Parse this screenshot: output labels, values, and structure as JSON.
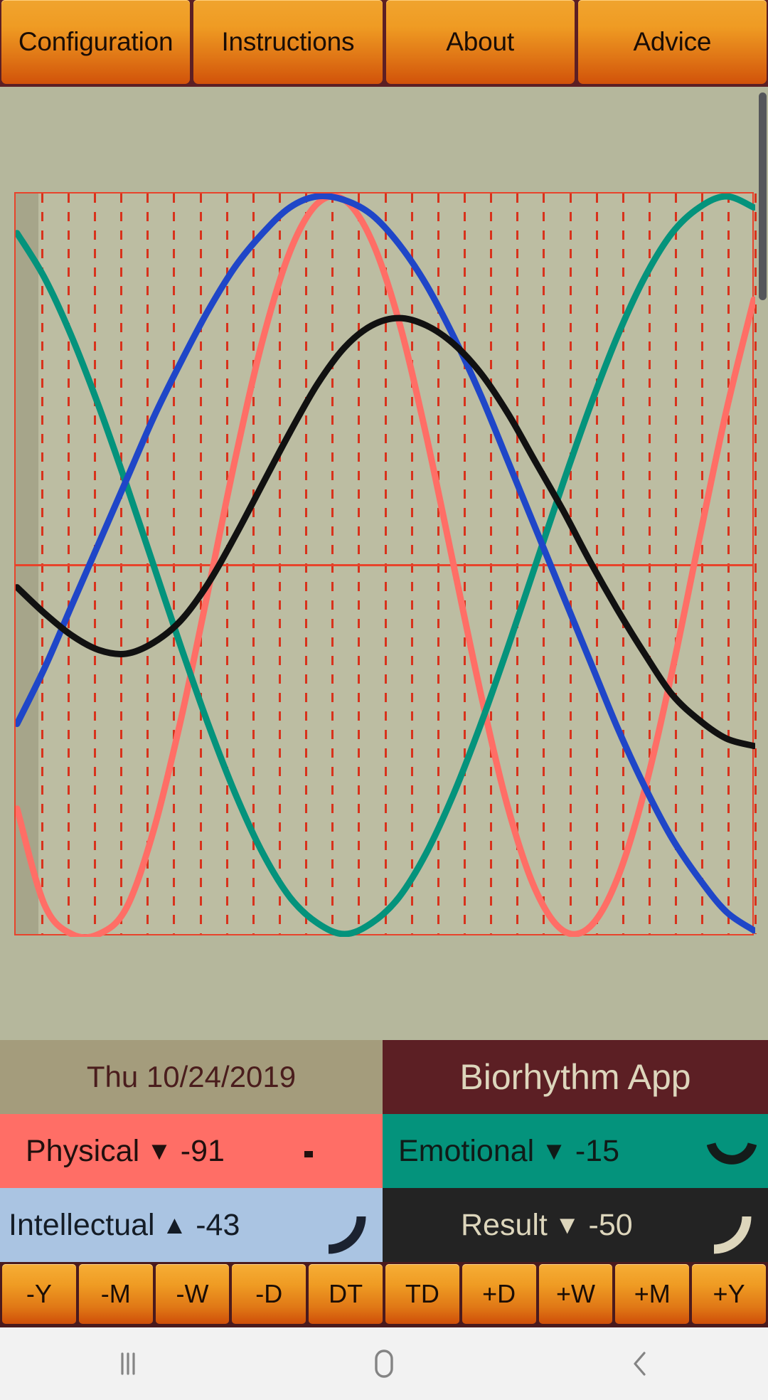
{
  "topbar": {
    "buttons": [
      {
        "label": "Configuration",
        "name": "tab-configuration"
      },
      {
        "label": "Instructions",
        "name": "tab-instructions"
      },
      {
        "label": "About",
        "name": "tab-about"
      },
      {
        "label": "Advice",
        "name": "tab-advice"
      }
    ]
  },
  "info": {
    "date": "Thu 10/24/2019",
    "app_title": "Biorhythm App",
    "physical": {
      "label": "Physical",
      "trend": "▼",
      "value": "-91"
    },
    "emotional": {
      "label": "Emotional",
      "trend": "▼",
      "value": "-15"
    },
    "intellectual": {
      "label": "Intellectual",
      "trend": "▲",
      "value": "-43"
    },
    "result": {
      "label": "Result",
      "trend": "▼",
      "value": "-50"
    }
  },
  "steps": {
    "buttons": [
      "-Y",
      "-M",
      "-W",
      "-D",
      "DT",
      "TD",
      "+D",
      "+W",
      "+M",
      "+Y"
    ]
  },
  "navbar": {
    "recents": "recents-icon",
    "home": "home-icon",
    "back": "back-icon"
  },
  "colors": {
    "physical": "#ff6e66",
    "emotional": "#04937c",
    "intellectual": "#1f46c8",
    "result": "#111111",
    "grid": "#d8321c",
    "border": "#e8432b",
    "background": "#b5b79c",
    "accent": "#5c1f24",
    "button": "#ef9b23"
  },
  "chart_data": {
    "type": "line",
    "title": "",
    "xlabel": "",
    "ylabel": "",
    "ylim": [
      -100,
      100
    ],
    "grid": true,
    "legend": "bottom-panel",
    "gridline_count": 28,
    "x_domain_days": 28,
    "today_index": 1,
    "series": [
      {
        "name": "Physical",
        "color": "#ff6e66",
        "period_days": 23,
        "value_today": -91,
        "trend": "down",
        "points": [
          [
            0,
            -66
          ],
          [
            1,
            -92
          ],
          [
            2,
            -100
          ],
          [
            3,
            -100
          ],
          [
            4,
            -93
          ],
          [
            5,
            -72
          ],
          [
            6,
            -42
          ],
          [
            7,
            -7
          ],
          [
            8,
            29
          ],
          [
            9,
            61
          ],
          [
            10,
            85
          ],
          [
            11,
            98
          ],
          [
            12,
            99
          ],
          [
            13,
            88
          ],
          [
            14,
            66
          ],
          [
            15,
            35
          ],
          [
            16,
            0
          ],
          [
            17,
            -35
          ],
          [
            18,
            -66
          ],
          [
            19,
            -88
          ],
          [
            20,
            -99
          ],
          [
            21,
            -98
          ],
          [
            22,
            -85
          ],
          [
            23,
            -61
          ],
          [
            24,
            -29
          ],
          [
            25,
            7
          ],
          [
            26,
            42
          ],
          [
            27,
            72
          ]
        ]
      },
      {
        "name": "Emotional",
        "color": "#04937c",
        "period_days": 28,
        "value_today": -15,
        "trend": "down",
        "points": [
          [
            0,
            90
          ],
          [
            1,
            78
          ],
          [
            2,
            62
          ],
          [
            3,
            43
          ],
          [
            4,
            22
          ],
          [
            5,
            0
          ],
          [
            6,
            -22
          ],
          [
            7,
            -43
          ],
          [
            8,
            -62
          ],
          [
            9,
            -78
          ],
          [
            10,
            -90
          ],
          [
            11,
            -97
          ],
          [
            12,
            -100
          ],
          [
            13,
            -97
          ],
          [
            14,
            -90
          ],
          [
            15,
            -78
          ],
          [
            16,
            -62
          ],
          [
            17,
            -43
          ],
          [
            18,
            -22
          ],
          [
            19,
            0
          ],
          [
            20,
            22
          ],
          [
            21,
            43
          ],
          [
            22,
            62
          ],
          [
            23,
            78
          ],
          [
            24,
            90
          ],
          [
            25,
            97
          ],
          [
            26,
            100
          ],
          [
            27,
            97
          ]
        ]
      },
      {
        "name": "Intellectual",
        "color": "#1f46c8",
        "period_days": 33,
        "value_today": -43,
        "trend": "up",
        "points": [
          [
            0,
            -43
          ],
          [
            1,
            -28
          ],
          [
            2,
            -11
          ],
          [
            3,
            6
          ],
          [
            4,
            23
          ],
          [
            5,
            40
          ],
          [
            6,
            55
          ],
          [
            7,
            69
          ],
          [
            8,
            81
          ],
          [
            9,
            90
          ],
          [
            10,
            97
          ],
          [
            11,
            100
          ],
          [
            12,
            99
          ],
          [
            13,
            95
          ],
          [
            14,
            87
          ],
          [
            15,
            76
          ],
          [
            16,
            62
          ],
          [
            17,
            46
          ],
          [
            18,
            28
          ],
          [
            19,
            10
          ],
          [
            20,
            -8
          ],
          [
            21,
            -26
          ],
          [
            22,
            -44
          ],
          [
            23,
            -60
          ],
          [
            24,
            -74
          ],
          [
            25,
            -85
          ],
          [
            26,
            -94
          ],
          [
            27,
            -99
          ]
        ]
      },
      {
        "name": "Result",
        "color": "#111111",
        "value_today": -50,
        "trend": "down",
        "points": [
          [
            0,
            -6
          ],
          [
            1,
            -13
          ],
          [
            2,
            -19
          ],
          [
            3,
            -23
          ],
          [
            4,
            -24
          ],
          [
            5,
            -21
          ],
          [
            6,
            -15
          ],
          [
            7,
            -5
          ],
          [
            8,
            8
          ],
          [
            9,
            22
          ],
          [
            10,
            36
          ],
          [
            11,
            49
          ],
          [
            12,
            59
          ],
          [
            13,
            65
          ],
          [
            14,
            67
          ],
          [
            15,
            65
          ],
          [
            16,
            60
          ],
          [
            17,
            52
          ],
          [
            18,
            41
          ],
          [
            19,
            28
          ],
          [
            20,
            15
          ],
          [
            21,
            1
          ],
          [
            22,
            -12
          ],
          [
            23,
            -24
          ],
          [
            24,
            -35
          ],
          [
            25,
            -42
          ],
          [
            26,
            -47
          ],
          [
            27,
            -49
          ]
        ]
      }
    ]
  }
}
